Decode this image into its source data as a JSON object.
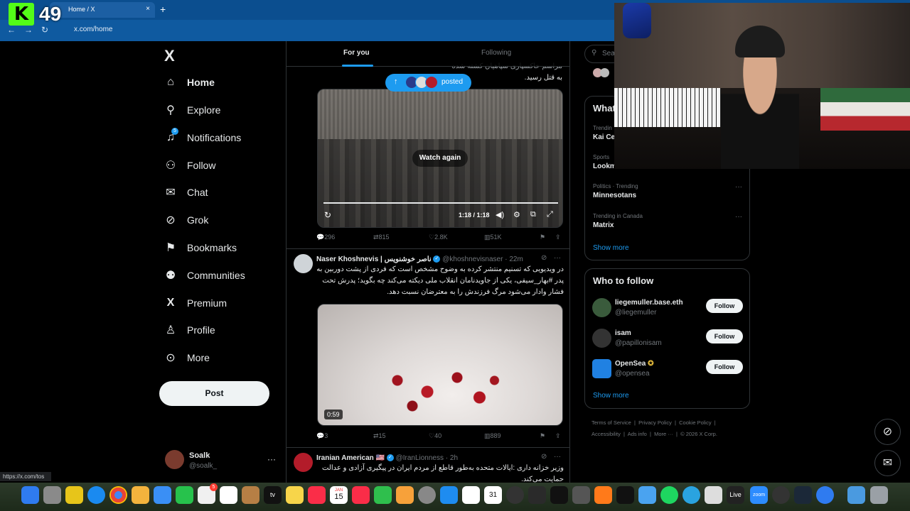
{
  "browser": {
    "tab_title": "Home / X",
    "tab_close": "×",
    "new_tab": "+",
    "url": "x.com/home",
    "status_url": "https://x.com/tos",
    "overlay_badge": "K",
    "overlay_number": "49"
  },
  "sidebar": {
    "logo": "X",
    "items": [
      {
        "label": "Home",
        "icon": "home-icon",
        "glyph": "⌂"
      },
      {
        "label": "Explore",
        "icon": "search-icon",
        "glyph": "⚲"
      },
      {
        "label": "Notifications",
        "icon": "bell-icon",
        "glyph": "🔔",
        "badge": "5"
      },
      {
        "label": "Follow",
        "icon": "follow-icon",
        "glyph": "⚇"
      },
      {
        "label": "Chat",
        "icon": "mail-icon",
        "glyph": "✉"
      },
      {
        "label": "Grok",
        "icon": "grok-icon",
        "glyph": "⊘"
      },
      {
        "label": "Bookmarks",
        "icon": "bookmark-icon",
        "glyph": "⚑"
      },
      {
        "label": "Communities",
        "icon": "communities-icon",
        "glyph": "⚉"
      },
      {
        "label": "Premium",
        "icon": "x-premium-icon",
        "glyph": "𝕏"
      },
      {
        "label": "Profile",
        "icon": "profile-icon",
        "glyph": "⚲"
      },
      {
        "label": "More",
        "icon": "more-circle-icon",
        "glyph": "⊙"
      }
    ],
    "post_label": "Post",
    "account": {
      "name": "Soalk",
      "handle": "@soalk_",
      "menu": "···"
    }
  },
  "feed": {
    "tabs": [
      "For you",
      "Following"
    ],
    "new_posts_pill": "posted",
    "tweet0": {
      "text_tail": "به قتل رسید.",
      "video_overlay": "Watch again",
      "time": "1:18 / 1:18",
      "stats": {
        "replies": "296",
        "reposts": "815",
        "likes": "2.8K",
        "views": "51K"
      }
    },
    "tweet1": {
      "name": "Naser Khoshnevis | ناصر خوشنویس",
      "handle": "@khoshnevisnaser",
      "time": "· 22m",
      "text": "در ویدیویی که تسنیم منتشر کرده به وضوح مشخص است که فردی از پشت دوربین به پدر #بهار_سیفی، یکی از جاویدنامان انقلاب ملی دیکته می‌کند چه بگوید؛ پدرش تحت فشار وادار می‌شود مرگ فرزندش را به معترضان نسبت دهد.",
      "duration": "0:59",
      "stats": {
        "replies": "3",
        "reposts": "15",
        "likes": "40",
        "views": "889"
      }
    },
    "tweet2": {
      "name": "Iranian American 🇺🇸",
      "handle": "@IranLionness",
      "time": "· 2h",
      "text": "وزیر خزانه داری :ایالات متحده به‌طور قاطع از مردم ایران در پیگیری آزادی و عدالت حمایت می‌کند."
    }
  },
  "right": {
    "search_placeholder": "Sear",
    "trends_title": "What",
    "trends": [
      {
        "context": "Trendin",
        "name": "Kai Ce"
      },
      {
        "context": "Sports",
        "name": "Lookm"
      },
      {
        "context": "Politics · Trending",
        "name": "Minnesotans"
      },
      {
        "context": "Trending in Canada",
        "name": "Matrix"
      }
    ],
    "trends_more": "···",
    "show_more": "Show more",
    "who_title": "Who to follow",
    "who": [
      {
        "name": "liegemuller.base.eth",
        "handle": "@liegemuller",
        "color": "#3a5b3c"
      },
      {
        "name": "isam",
        "handle": "@papillonisam",
        "color": "#333"
      },
      {
        "name": "OpenSea",
        "handle": "@opensea",
        "color": "#2081e2"
      }
    ],
    "follow_label": "Follow",
    "who_more": "Show more",
    "footer": {
      "tos": "Terms of Service",
      "privacy": "Privacy Policy",
      "cookie": "Cookie Policy",
      "accessibility": "Accessibility",
      "ads": "Ads info",
      "more": "More ···",
      "copyright": "© 2026 X Corp."
    }
  },
  "dock": {
    "appletv": "tv",
    "calendar_month": "JAN",
    "calendar_day": "15",
    "calendar_small": "31",
    "live": "Live",
    "zoom": "zoom",
    "mail_badge": "5"
  }
}
